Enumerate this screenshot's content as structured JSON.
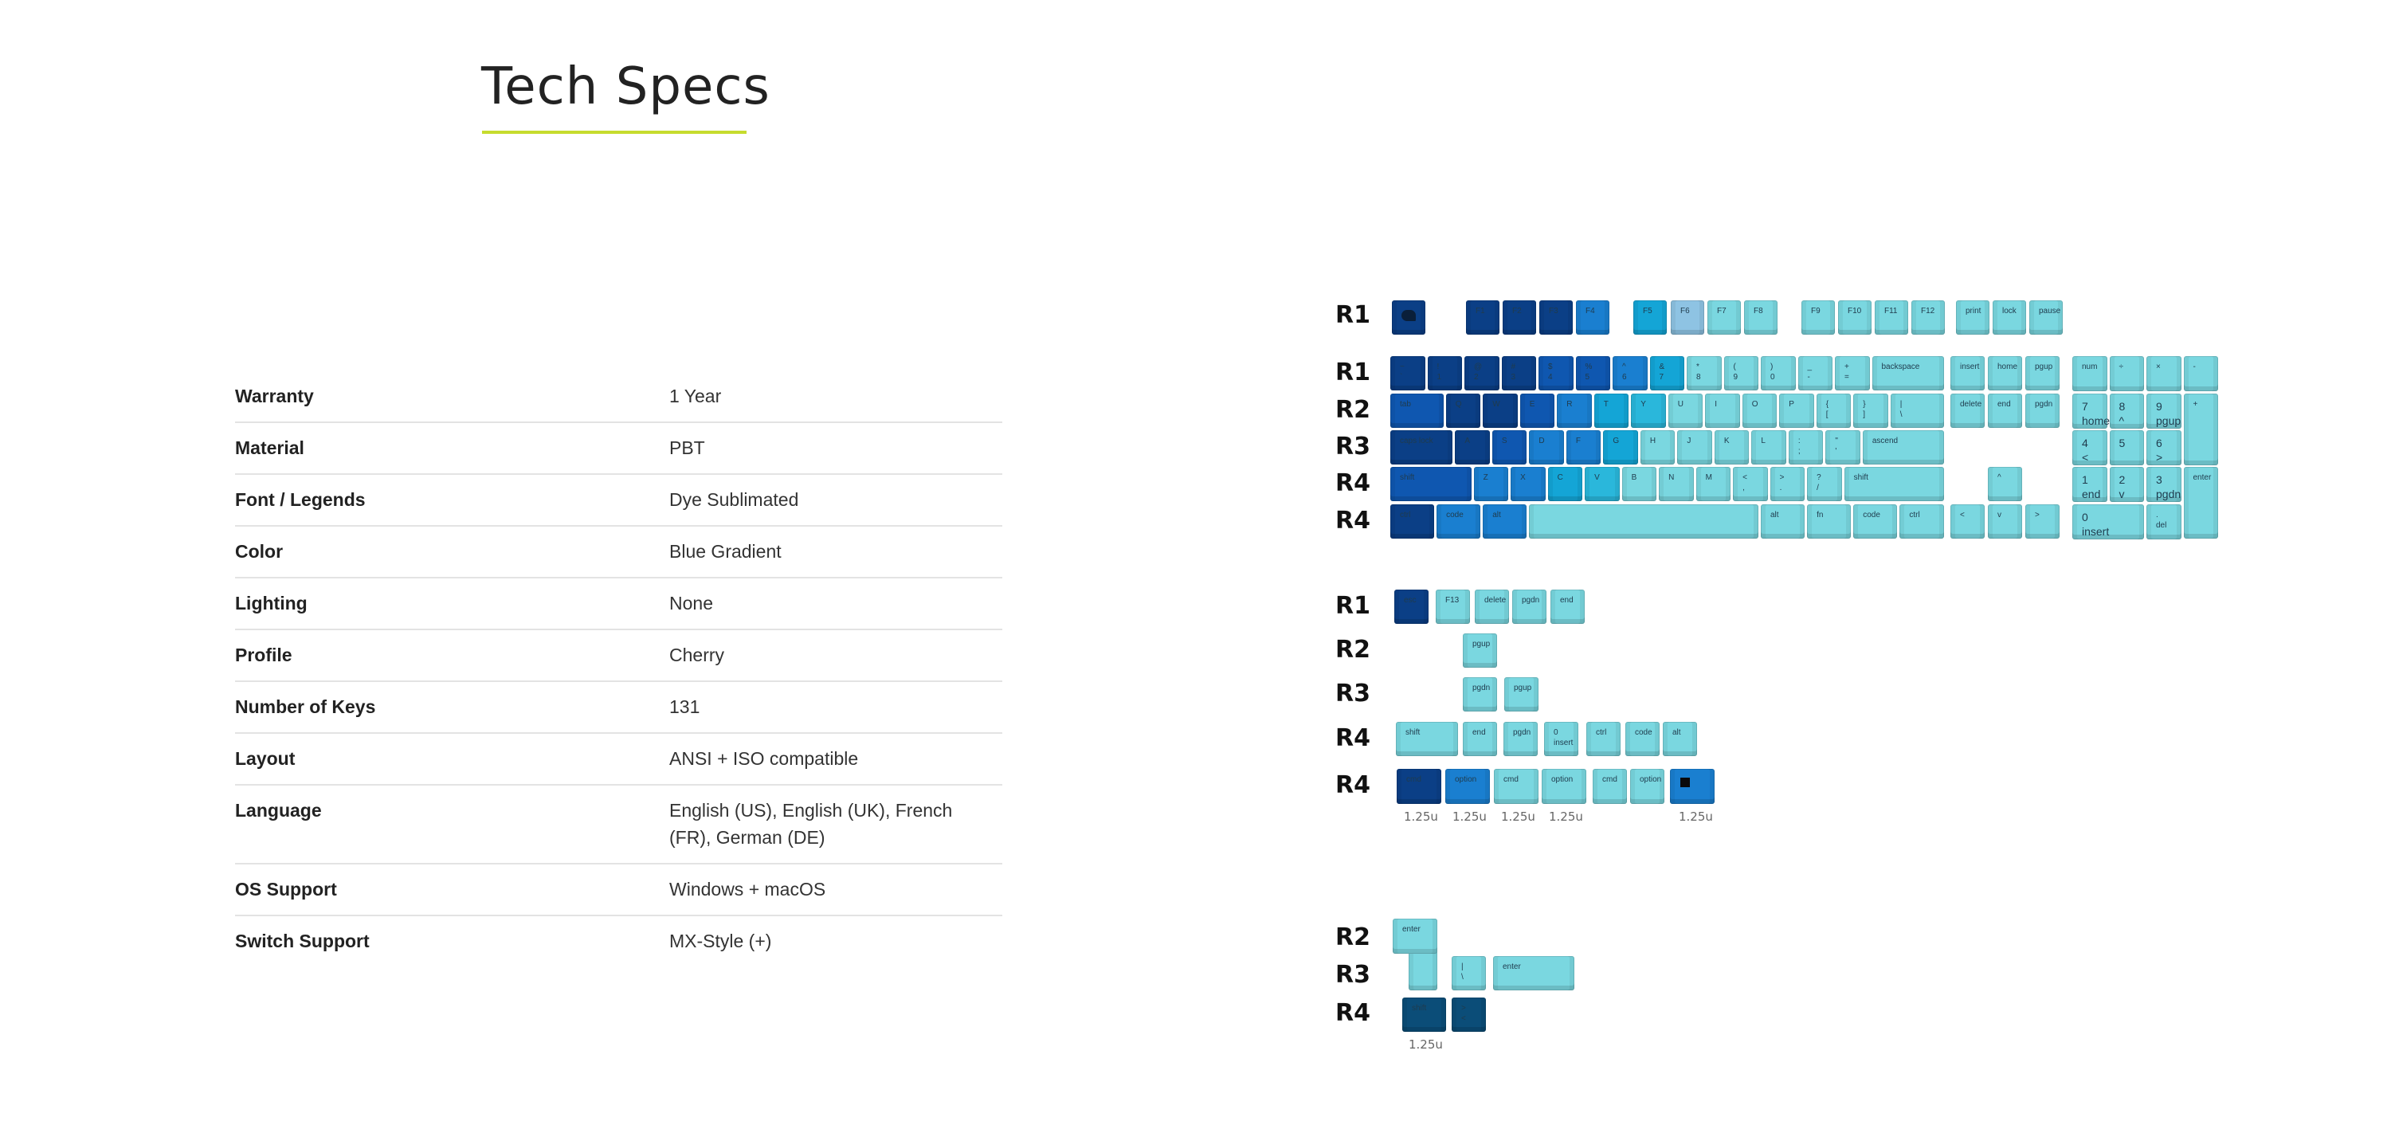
{
  "page": {
    "title": "Tech Specs",
    "accent_color": "#c6dc2e"
  },
  "specs": [
    {
      "label": "Warranty",
      "value": "1 Year"
    },
    {
      "label": "Material",
      "value": "PBT"
    },
    {
      "label": "Font / Legends",
      "value": "Dye Sublimated"
    },
    {
      "label": "Color",
      "value": "Blue Gradient"
    },
    {
      "label": "Lighting",
      "value": "None"
    },
    {
      "label": "Profile",
      "value": "Cherry"
    },
    {
      "label": "Number of Keys",
      "value": "131"
    },
    {
      "label": "Layout",
      "value": "ANSI + ISO compatible"
    },
    {
      "label": "Language",
      "value": "English (US), English (UK), French (FR), German (DE)"
    },
    {
      "label": "OS Support",
      "value": "Windows + macOS"
    },
    {
      "label": "Switch Support",
      "value": "MX-Style (+)"
    }
  ],
  "keyboard_image": {
    "colors": {
      "navy": "#0b3f86",
      "royal": "#0f57b0",
      "blue": "#1a7fd0",
      "cyan": "#14a5d6",
      "teal": "#2ab7db",
      "lilac": "#8ec3e3",
      "light": "#7ad7e0",
      "darkteal": "#0b4d78"
    },
    "row_labels": {
      "fn_row": "R1",
      "main": [
        "R1",
        "R2",
        "R3",
        "R4",
        "R4"
      ],
      "extras": [
        "R1",
        "R2",
        "R3",
        "R4",
        "R4"
      ],
      "iso": [
        "R2",
        "R3",
        "R4"
      ]
    },
    "unit_labels": {
      "mod_row": [
        "1.25u",
        "1.25u",
        "1.25u",
        "1.25u",
        "1.25u"
      ],
      "iso_row": [
        "1.25u"
      ]
    },
    "fn_row": [
      "logo",
      "F1",
      "F2",
      "F3",
      "F4",
      "F5",
      "F6",
      "F7",
      "F8",
      "F9",
      "F10",
      "F11",
      "F12",
      "print",
      "lock",
      "pause"
    ],
    "main_rows": [
      [
        "~\n`",
        "!\n1",
        "@\n2",
        "#\n3",
        "$\n4",
        "%\n5",
        "^\n6",
        "&\n7",
        "*\n8",
        "(\n9",
        ")\n0",
        "_\n-",
        "+\n=",
        "backspace"
      ],
      [
        "tab",
        "Q",
        "W",
        "E",
        "R",
        "T",
        "Y",
        "U",
        "I",
        "O",
        "P",
        "{\n[",
        "}\n]",
        "|\n\\"
      ],
      [
        "caps lock",
        "A",
        "S",
        "D",
        "F",
        "G",
        "H",
        "J",
        "K",
        "L",
        ":\n;",
        "\"\n'",
        "ascend"
      ],
      [
        "shift",
        "Z",
        "X",
        "C",
        "V",
        "B",
        "N",
        "M",
        "<\n,",
        ">\n.",
        "?\n/",
        "shift"
      ],
      [
        "ctrl",
        "code",
        "alt",
        "",
        "alt",
        "fn",
        "code",
        "ctrl"
      ]
    ],
    "nav_cluster": [
      "insert",
      "home",
      "pgup",
      "delete",
      "end",
      "pgdn",
      "^",
      "<",
      "v",
      ">"
    ],
    "numpad": [
      "num",
      "÷",
      "×",
      "-",
      "7\nhome",
      "8\n^",
      "9\npgup",
      "+",
      "4\n<",
      "5",
      "6\n>",
      "1\nend",
      "2\nv",
      "3\npgdn",
      "enter",
      "0\ninsert",
      ".\ndel"
    ],
    "extras": {
      "r1": [
        "esc",
        "F13",
        "delete",
        "pgdn",
        "end"
      ],
      "r2": [
        "pgup"
      ],
      "r3": [
        "pgdn",
        "pgup"
      ],
      "r4a": [
        "shift",
        "end",
        "pgdn",
        "0\ninsert",
        "ctrl",
        "code",
        "alt"
      ],
      "r4b": [
        "cmd",
        "option",
        "cmd",
        "option",
        "cmd",
        "option",
        "windows"
      ]
    },
    "iso": {
      "r2": [
        "enter"
      ],
      "r3": [
        "|\n\\",
        "enter"
      ],
      "r4": [
        "shift",
        ">\n<"
      ]
    }
  }
}
